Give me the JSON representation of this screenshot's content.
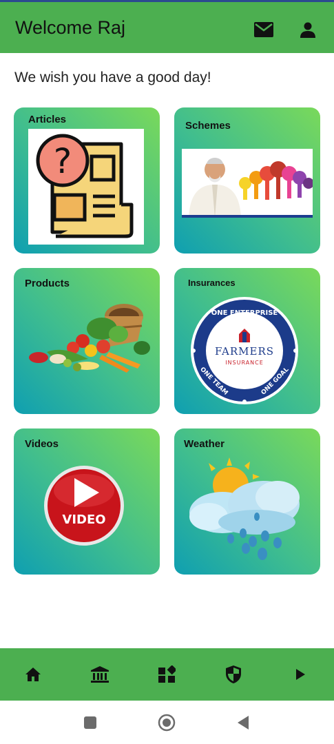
{
  "app_bar": {
    "title": "Welcome Raj",
    "icons": [
      "mail-icon",
      "person-icon"
    ]
  },
  "greeting": "We wish you have a good day!",
  "cards": [
    {
      "label": "Articles",
      "image": "newspaper-question-icon"
    },
    {
      "label": "Schemes",
      "image": "schemes-banner-image"
    },
    {
      "label": "Products",
      "image": "vegetables-basket-image"
    },
    {
      "label": "Insurances",
      "image": "farmers-insurance-logo",
      "logo_text": {
        "top": "ONE ENTERPRISE",
        "brand": "FARMERS",
        "sub": "INSURANCE",
        "left": "ONE TEAM",
        "right": "ONE GOAL"
      }
    },
    {
      "label": "Videos",
      "image": "video-play-button",
      "badge_text": "VIDEO"
    },
    {
      "label": "Weather",
      "image": "sun-cloud-rain-icon"
    }
  ],
  "bottom_nav": {
    "items": [
      "home-icon",
      "bank-icon",
      "widgets-icon",
      "shield-icon",
      "play-arrow-icon"
    ]
  },
  "system_nav": [
    "square-recents-icon",
    "circle-home-icon",
    "triangle-back-icon"
  ],
  "colors": {
    "app_bar": "#4caf50",
    "card_gradient_start": "#0f9fb1",
    "card_gradient_end": "#7ad95a",
    "video_red": "#c8141b"
  }
}
